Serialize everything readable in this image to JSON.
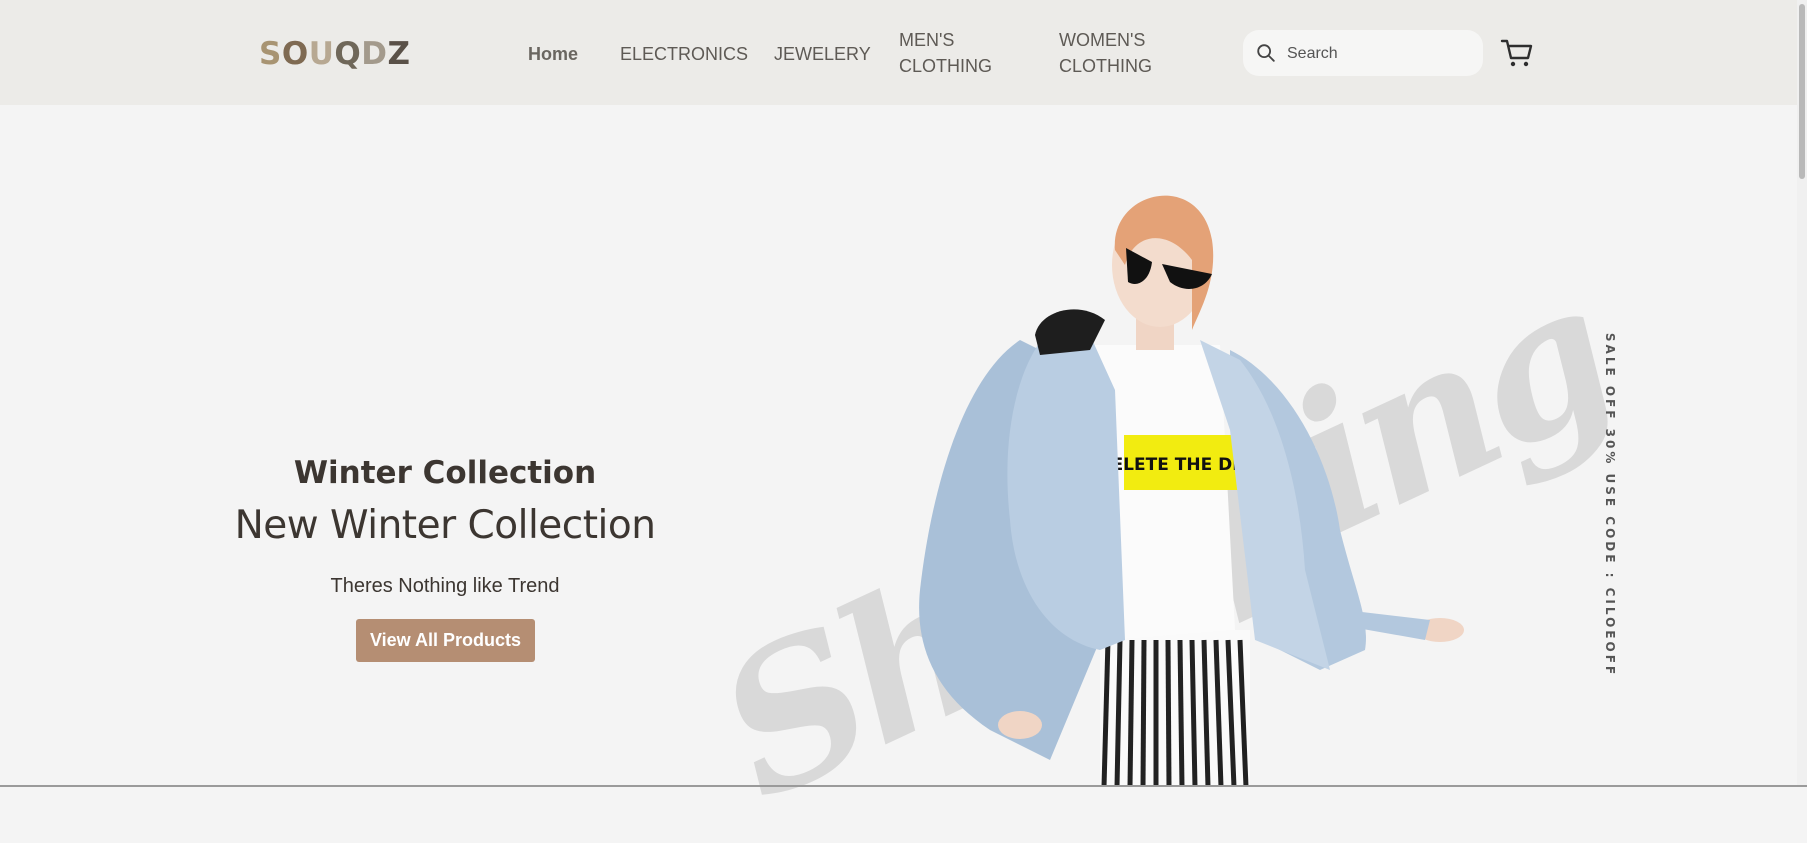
{
  "header": {
    "logo": {
      "letters": [
        "S",
        "O",
        "U",
        "Q",
        "D",
        "Z"
      ],
      "colors": [
        "#a89472",
        "#7f6a52",
        "#b7a892",
        "#6f6759",
        "#a39a8c",
        "#5a5148"
      ]
    },
    "nav": [
      {
        "label": "Home"
      },
      {
        "label": "ELECTRONICS"
      },
      {
        "label": "JEWELERY"
      },
      {
        "label": "MEN'S CLOTHING",
        "line1": "MEN'S",
        "line2": "CLOTHING"
      },
      {
        "label": "WOMEN'S CLOTHING",
        "line1": "WOMEN'S",
        "line2": "CLOTHING"
      }
    ],
    "search": {
      "placeholder": "Search",
      "icon": "search-icon"
    },
    "cart": {
      "icon": "cart-icon"
    }
  },
  "hero": {
    "subtitle": "Winter Collection",
    "title": "New Winter Collection",
    "tagline": "Theres Nothing like Trend",
    "cta_label": "View All Products",
    "watermark": "Shopping",
    "tshirt_text": "DELETE THE DRAMA",
    "promo": "SALE OFF 30% USE CODE : CILOEOFF"
  },
  "colors": {
    "header_bg": "#ecebe8",
    "page_bg": "#f4f4f4",
    "accent": "#b58e73",
    "text_dark": "#3c3631"
  }
}
